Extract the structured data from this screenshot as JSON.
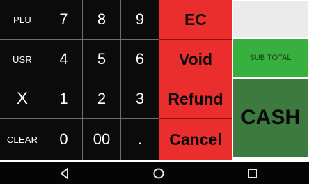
{
  "keypad": {
    "rows": [
      [
        "PLU",
        "7",
        "8",
        "9"
      ],
      [
        "USR",
        "4",
        "5",
        "6"
      ],
      [
        "X",
        "1",
        "2",
        "3"
      ],
      [
        "CLEAR",
        "0",
        "00",
        "."
      ]
    ]
  },
  "actions": {
    "ec": "EC",
    "void": "Void",
    "refund": "Refund",
    "cancel": "Cancel"
  },
  "panel": {
    "subtotal": "SUB TOTAL",
    "cash": "CASH"
  },
  "colors": {
    "keypad_bg": "#0b0b0b",
    "action_red": "#ea2d2d",
    "subtotal_green": "#38b03f",
    "cash_green": "#3d7a40",
    "navbar": "#050505"
  },
  "navbar": {
    "icons": [
      "back-icon",
      "home-icon",
      "recent-apps-icon"
    ]
  }
}
